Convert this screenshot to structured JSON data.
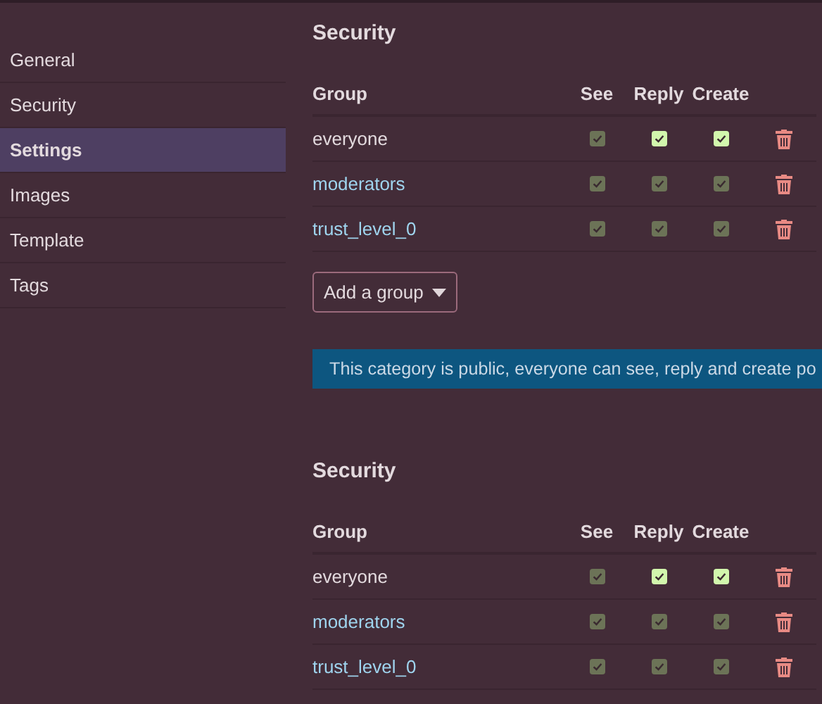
{
  "sidebar": {
    "items": [
      {
        "label": "General",
        "selected": false
      },
      {
        "label": "Security",
        "selected": false
      },
      {
        "label": "Settings",
        "selected": true
      },
      {
        "label": "Images",
        "selected": false
      },
      {
        "label": "Template",
        "selected": false
      },
      {
        "label": "Tags",
        "selected": false
      }
    ]
  },
  "sections": [
    {
      "title": "Security",
      "columns": [
        "Group",
        "See",
        "Reply",
        "Create"
      ],
      "rows": [
        {
          "group": "everyone",
          "kind": "text",
          "permissions": [
            {
              "checked": true,
              "disabled": true
            },
            {
              "checked": true,
              "disabled": false
            },
            {
              "checked": true,
              "disabled": false
            }
          ]
        },
        {
          "group": "moderators",
          "kind": "link",
          "permissions": [
            {
              "checked": true,
              "disabled": true
            },
            {
              "checked": true,
              "disabled": true
            },
            {
              "checked": true,
              "disabled": true
            }
          ]
        },
        {
          "group": "trust_level_0",
          "kind": "link",
          "permissions": [
            {
              "checked": true,
              "disabled": true
            },
            {
              "checked": true,
              "disabled": true
            },
            {
              "checked": true,
              "disabled": true
            }
          ]
        }
      ],
      "add_button": "Add a group",
      "notice": "This category is public, everyone can see, reply and create po"
    },
    {
      "title": "Security",
      "columns": [
        "Group",
        "See",
        "Reply",
        "Create"
      ],
      "rows": [
        {
          "group": "everyone",
          "kind": "text",
          "permissions": [
            {
              "checked": true,
              "disabled": true
            },
            {
              "checked": true,
              "disabled": false
            },
            {
              "checked": true,
              "disabled": false
            }
          ]
        },
        {
          "group": "moderators",
          "kind": "link",
          "permissions": [
            {
              "checked": true,
              "disabled": true
            },
            {
              "checked": true,
              "disabled": true
            },
            {
              "checked": true,
              "disabled": true
            }
          ]
        },
        {
          "group": "trust_level_0",
          "kind": "link",
          "permissions": [
            {
              "checked": true,
              "disabled": true
            },
            {
              "checked": true,
              "disabled": true
            },
            {
              "checked": true,
              "disabled": true
            }
          ]
        }
      ]
    }
  ]
}
